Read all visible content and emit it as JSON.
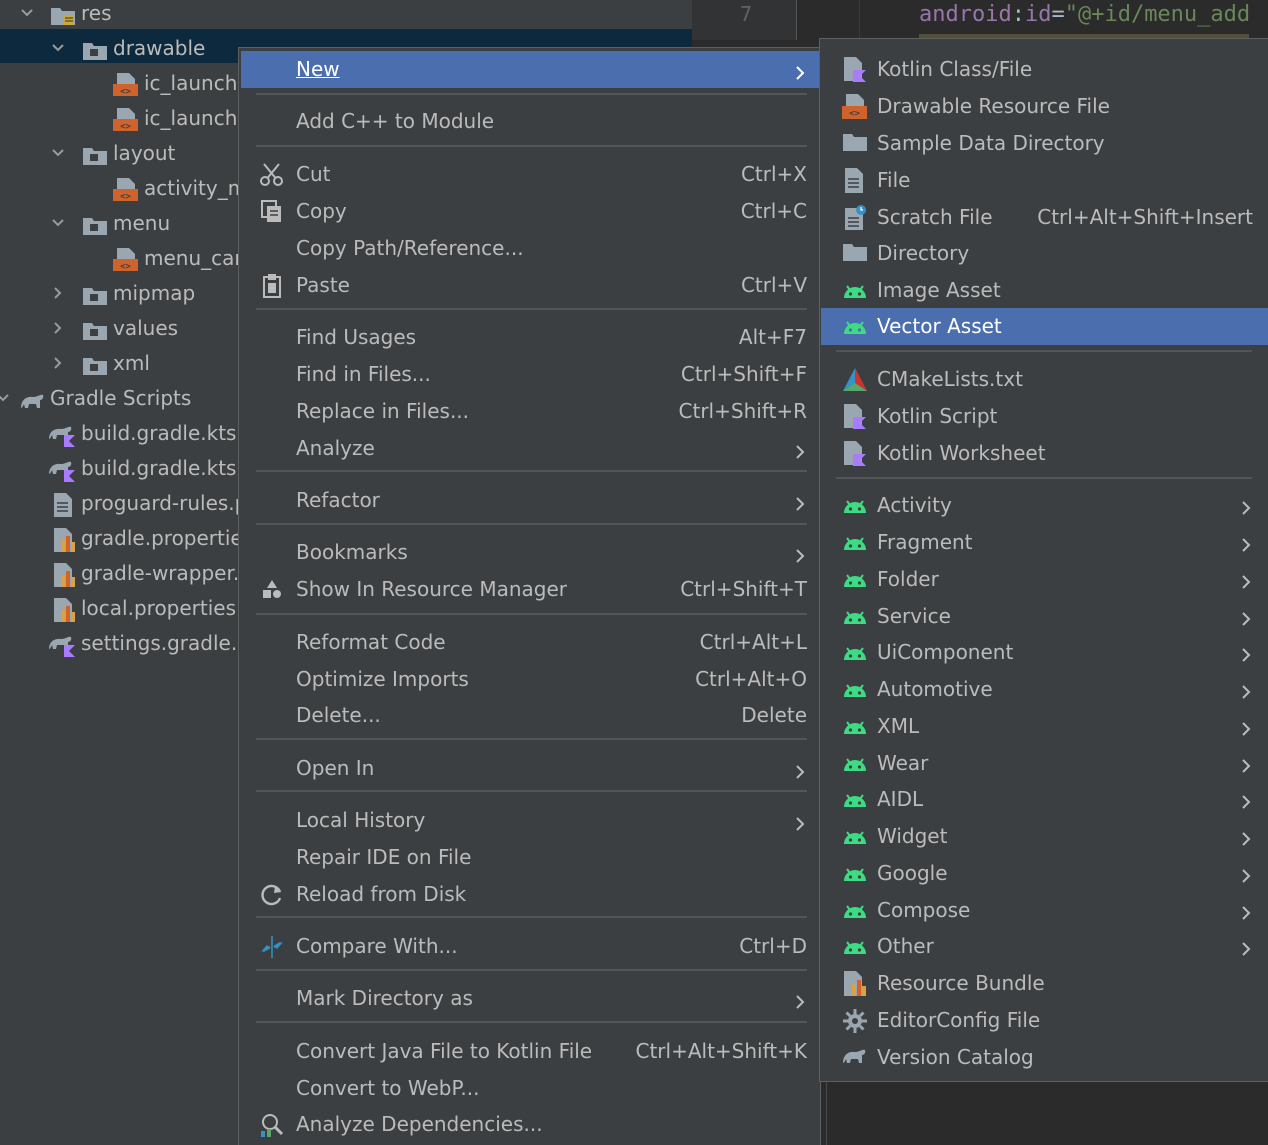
{
  "tree": {
    "items": [
      {
        "label": "res",
        "icon": "folder-res-icon"
      },
      {
        "label": "drawable",
        "icon": "folder-icon"
      },
      {
        "label": "ic_launche",
        "icon": "xml-file-icon"
      },
      {
        "label": "ic_launche",
        "icon": "xml-file-icon"
      },
      {
        "label": "layout",
        "icon": "folder-icon"
      },
      {
        "label": "activity_m",
        "icon": "xml-file-icon"
      },
      {
        "label": "menu",
        "icon": "folder-icon"
      },
      {
        "label": "menu_card",
        "icon": "xml-file-icon"
      },
      {
        "label": "mipmap",
        "icon": "folder-icon"
      },
      {
        "label": "values",
        "icon": "folder-icon"
      },
      {
        "label": "xml",
        "icon": "folder-icon"
      },
      {
        "label": "Gradle Scripts",
        "icon": "gradle-icon"
      },
      {
        "label": "build.gradle.kts (",
        "icon": "gradle-kts-icon"
      },
      {
        "label": "build.gradle.kts (",
        "icon": "gradle-kts-icon"
      },
      {
        "label": "proguard-rules.p",
        "icon": "text-file-icon"
      },
      {
        "label": "gradle.properties",
        "icon": "properties-icon"
      },
      {
        "label": "gradle-wrapper.p",
        "icon": "properties-icon"
      },
      {
        "label": "local.properties (",
        "icon": "properties-icon"
      },
      {
        "label": "settings.gradle.kt",
        "icon": "gradle-kts-icon"
      }
    ]
  },
  "editor": {
    "line_number": "7",
    "code": {
      "attr": "android",
      "colon": ":",
      "name": "id",
      "eq": "=",
      "value": "\"@+id/menu_add"
    }
  },
  "menu": {
    "items": [
      {
        "label": "New",
        "underline": "N",
        "shortcut": "",
        "submenu": true,
        "icon": ""
      },
      {
        "label": "Add C++ to Module",
        "shortcut": "",
        "icon": ""
      },
      {
        "label": "Cut",
        "shortcut": "Ctrl+X",
        "icon": "scissors-icon"
      },
      {
        "label": "Copy",
        "shortcut": "Ctrl+C",
        "icon": "copy-icon"
      },
      {
        "label": "Copy Path/Reference...",
        "shortcut": "",
        "icon": ""
      },
      {
        "label": "Paste",
        "shortcut": "Ctrl+V",
        "icon": "paste-icon"
      },
      {
        "label": "Find Usages",
        "shortcut": "Alt+F7",
        "icon": ""
      },
      {
        "label": "Find in Files...",
        "shortcut": "Ctrl+Shift+F",
        "icon": ""
      },
      {
        "label": "Replace in Files...",
        "shortcut": "Ctrl+Shift+R",
        "icon": ""
      },
      {
        "label": "Analyze",
        "shortcut": "",
        "submenu": true,
        "icon": ""
      },
      {
        "label": "Refactor",
        "shortcut": "",
        "submenu": true,
        "icon": ""
      },
      {
        "label": "Bookmarks",
        "shortcut": "",
        "submenu": true,
        "icon": ""
      },
      {
        "label": "Show In Resource Manager",
        "shortcut": "Ctrl+Shift+T",
        "icon": "resource-manager-icon"
      },
      {
        "label": "Reformat Code",
        "shortcut": "Ctrl+Alt+L",
        "icon": ""
      },
      {
        "label": "Optimize Imports",
        "shortcut": "Ctrl+Alt+O",
        "icon": ""
      },
      {
        "label": "Delete...",
        "shortcut": "Delete",
        "icon": ""
      },
      {
        "label": "Open In",
        "shortcut": "",
        "submenu": true,
        "icon": ""
      },
      {
        "label": "Local History",
        "shortcut": "",
        "submenu": true,
        "icon": ""
      },
      {
        "label": "Repair IDE on File",
        "shortcut": "",
        "icon": ""
      },
      {
        "label": "Reload from Disk",
        "shortcut": "",
        "icon": "reload-icon"
      },
      {
        "label": "Compare With...",
        "shortcut": "Ctrl+D",
        "icon": "compare-icon"
      },
      {
        "label": "Mark Directory as",
        "shortcut": "",
        "submenu": true,
        "icon": ""
      },
      {
        "label": "Convert Java File to Kotlin File",
        "shortcut": "Ctrl+Alt+Shift+K",
        "icon": ""
      },
      {
        "label": "Convert to WebP...",
        "shortcut": "",
        "icon": ""
      },
      {
        "label": "Analyze Dependencies...",
        "shortcut": "",
        "icon": "dependencies-icon"
      }
    ]
  },
  "submenu": {
    "items": [
      {
        "label": "Kotlin Class/File",
        "shortcut": "",
        "icon": "kotlin-file-icon"
      },
      {
        "label": "Drawable Resource File",
        "shortcut": "",
        "icon": "xml-file-icon"
      },
      {
        "label": "Sample Data Directory",
        "shortcut": "",
        "icon": "folder-icon"
      },
      {
        "label": "File",
        "shortcut": "",
        "icon": "file-icon"
      },
      {
        "label": "Scratch File",
        "shortcut": "Ctrl+Alt+Shift+Insert",
        "icon": "scratch-file-icon"
      },
      {
        "label": "Directory",
        "shortcut": "",
        "icon": "folder-icon"
      },
      {
        "label": "Image Asset",
        "shortcut": "",
        "icon": "android-icon"
      },
      {
        "label": "Vector Asset",
        "shortcut": "",
        "icon": "android-icon"
      },
      {
        "label": "CMakeLists.txt",
        "shortcut": "",
        "icon": "cmake-icon"
      },
      {
        "label": "Kotlin Script",
        "shortcut": "",
        "icon": "kotlin-script-icon"
      },
      {
        "label": "Kotlin Worksheet",
        "shortcut": "",
        "icon": "kotlin-script-icon"
      },
      {
        "label": "Activity",
        "shortcut": "",
        "submenu": true,
        "icon": "android-icon"
      },
      {
        "label": "Fragment",
        "shortcut": "",
        "submenu": true,
        "icon": "android-icon"
      },
      {
        "label": "Folder",
        "shortcut": "",
        "submenu": true,
        "icon": "android-icon"
      },
      {
        "label": "Service",
        "shortcut": "",
        "submenu": true,
        "icon": "android-icon"
      },
      {
        "label": "UiComponent",
        "shortcut": "",
        "submenu": true,
        "icon": "android-icon"
      },
      {
        "label": "Automotive",
        "shortcut": "",
        "submenu": true,
        "icon": "android-icon"
      },
      {
        "label": "XML",
        "shortcut": "",
        "submenu": true,
        "icon": "android-icon"
      },
      {
        "label": "Wear",
        "shortcut": "",
        "submenu": true,
        "icon": "android-icon"
      },
      {
        "label": "AIDL",
        "shortcut": "",
        "submenu": true,
        "icon": "android-icon"
      },
      {
        "label": "Widget",
        "shortcut": "",
        "submenu": true,
        "icon": "android-icon"
      },
      {
        "label": "Google",
        "shortcut": "",
        "submenu": true,
        "icon": "android-icon"
      },
      {
        "label": "Compose",
        "shortcut": "",
        "submenu": true,
        "icon": "android-icon"
      },
      {
        "label": "Other",
        "shortcut": "",
        "submenu": true,
        "icon": "android-icon"
      },
      {
        "label": "Resource Bundle",
        "shortcut": "",
        "icon": "properties-icon"
      },
      {
        "label": "EditorConfig File",
        "shortcut": "",
        "icon": "gear-icon"
      },
      {
        "label": "Version Catalog",
        "shortcut": "",
        "icon": "gradle-icon"
      }
    ]
  },
  "colors": {
    "selection": "#4b6eaf",
    "android_green": "#3ddc84",
    "xml_orange": "#d0632b",
    "kotlin_purple": "#a97bff"
  }
}
